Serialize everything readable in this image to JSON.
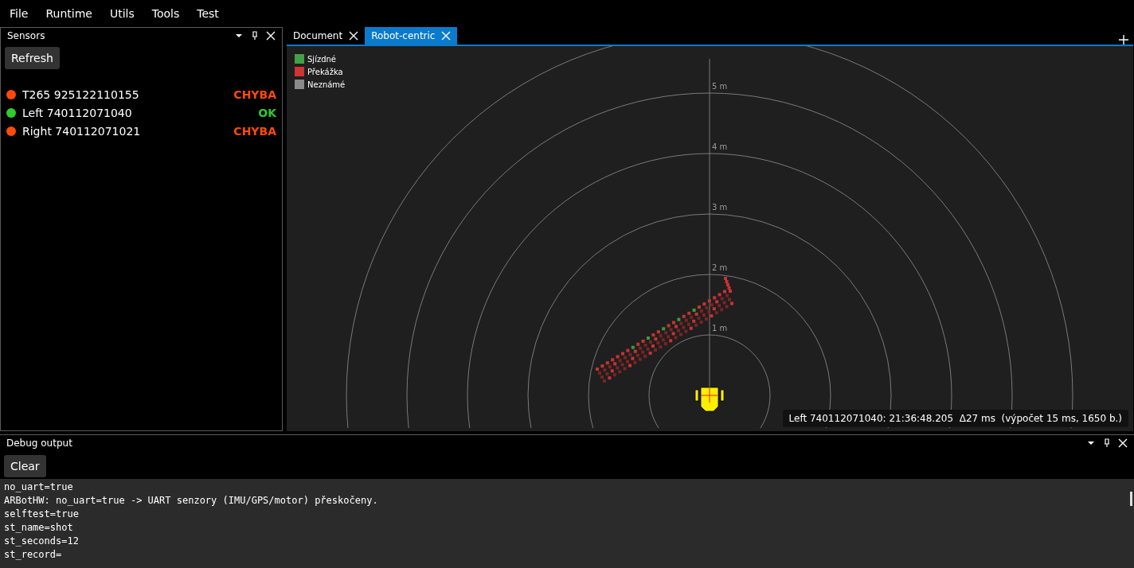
{
  "menu": [
    "File",
    "Runtime",
    "Utils",
    "Tools",
    "Test"
  ],
  "sensors_panel": {
    "title": "Sensors",
    "refresh_button": "Refresh",
    "sensors": [
      {
        "name": "T265 925122110155",
        "status": "CHYBA",
        "color": "#ff4a0a"
      },
      {
        "name": "Left 740112071040",
        "status": "OK",
        "color": "#2ecc2e"
      },
      {
        "name": "Right 740112071021",
        "status": "CHYBA",
        "color": "#ff4a0a"
      }
    ]
  },
  "tabs": [
    {
      "label": "Document",
      "selected": false
    },
    {
      "label": "Robot-centric",
      "selected": true
    }
  ],
  "radar": {
    "legend": [
      {
        "label": "Sjízdné",
        "color": "#43a047"
      },
      {
        "label": "Překážka",
        "color": "#d03434"
      },
      {
        "label": "Neznámé",
        "color": "#8a8a8a"
      }
    ],
    "ring_labels": [
      "5 m",
      "4 m",
      "3 m",
      "2 m",
      "1 m"
    ],
    "status": "Left 740112071040: 21:36:48.205  Δ27 ms  (výpočet 15 ms, 1650 b.)"
  },
  "debug_panel": {
    "title": "Debug output",
    "clear_button": "Clear",
    "lines": [
      "no_uart=true",
      "ARBotHW: no_uart=true -> UART senzory (IMU/GPS/motor) přeskočeny.",
      "selftest=true",
      "st_name=shot",
      "st_seconds=12",
      "st_record="
    ]
  }
}
